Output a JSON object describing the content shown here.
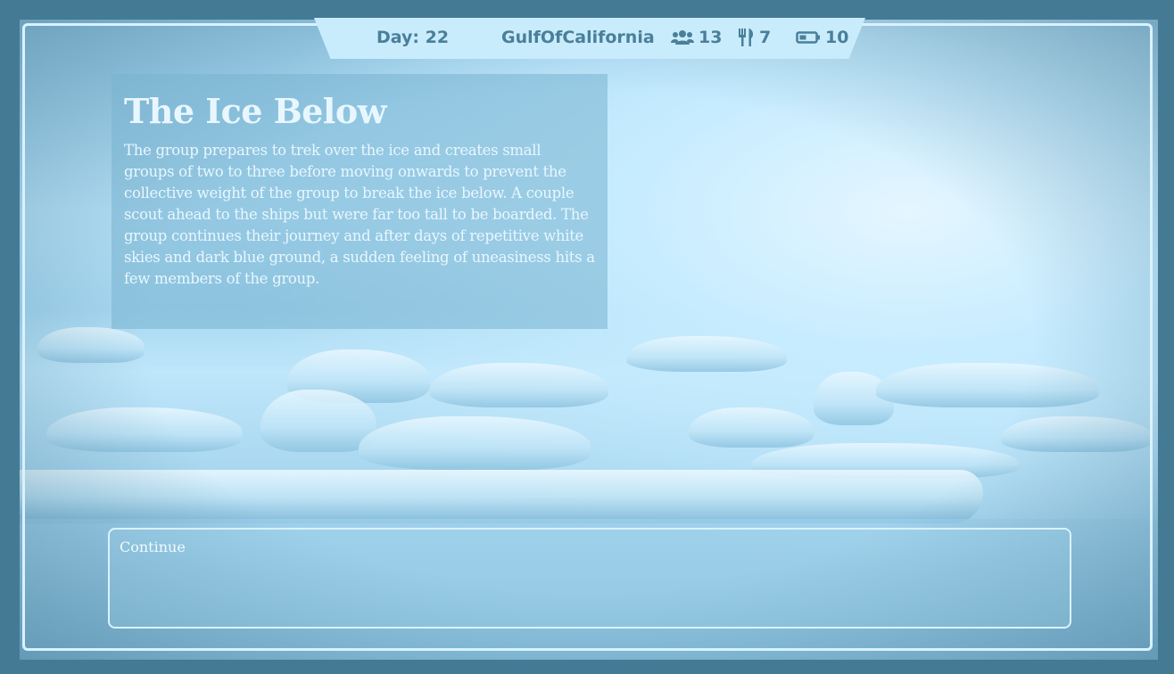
{
  "hud": {
    "day_label": "Day: 22",
    "location": "GulfOfCalifornia",
    "group_count": "13",
    "food_count": "7",
    "battery_count": "10",
    "icons": [
      "group-icon",
      "food-icon",
      "battery-icon"
    ]
  },
  "story": {
    "title": "The Ice Below",
    "body": "The group prepares to trek over the ice and creates small groups of two to three before moving onwards to prevent the collective weight of the group to break the ice below. A couple scout ahead to the ships but were far too tall to be boarded. The group continues their journey and after days of repetitive white skies and dark blue ground, a sudden feeling of uneasiness hits a few members of the group."
  },
  "choices": [
    {
      "label": "Continue"
    }
  ],
  "colors": {
    "outer_background": "#457a95",
    "hud_background": "#c9ecfd",
    "hud_text": "#4a7f9a",
    "frame_border": "#d9f2ff",
    "story_text": "#e8f7ff"
  }
}
